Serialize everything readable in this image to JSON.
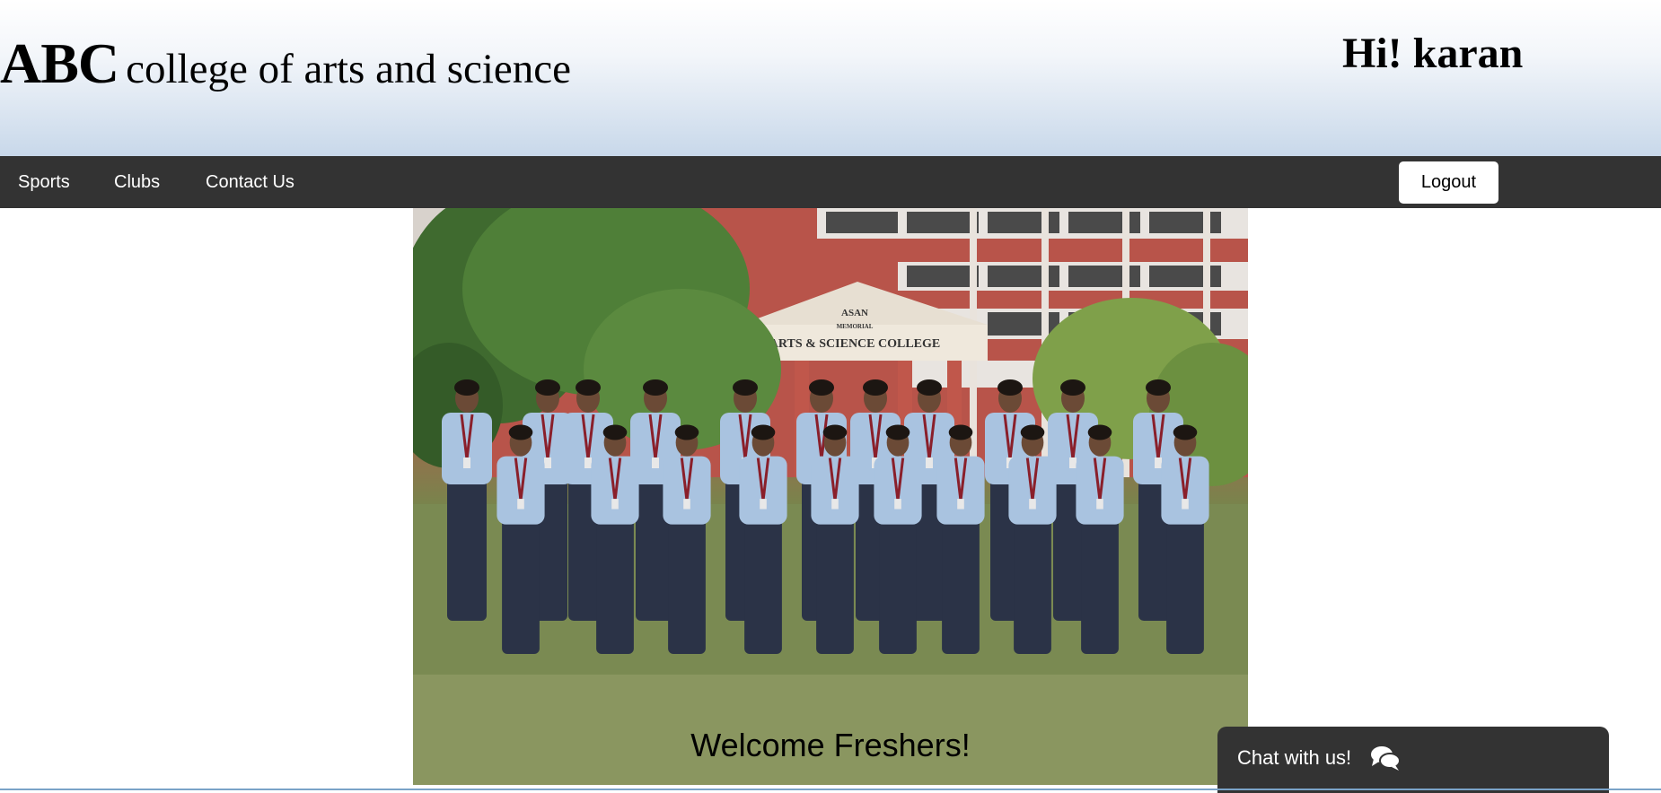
{
  "header": {
    "brand_abbr": "ABC",
    "brand_name": "college of arts and science",
    "greeting": "Hi! karan"
  },
  "nav": {
    "links": [
      "Sports",
      "Clubs",
      "Contact Us"
    ],
    "logout_label": "Logout"
  },
  "hero": {
    "sign_line1": "ASAN",
    "sign_line2": "MEMORIAL",
    "sign_line3": "ARTS & SCIENCE COLLEGE",
    "caption": "Welcome Freshers!"
  },
  "chat": {
    "label": "Chat with us!",
    "icon": "comments-icon"
  },
  "colors": {
    "navbar": "#333333",
    "header_gradient_bottom": "#c8d8ea",
    "shirt": "#a9c3e0",
    "trousers": "#2b3347"
  }
}
